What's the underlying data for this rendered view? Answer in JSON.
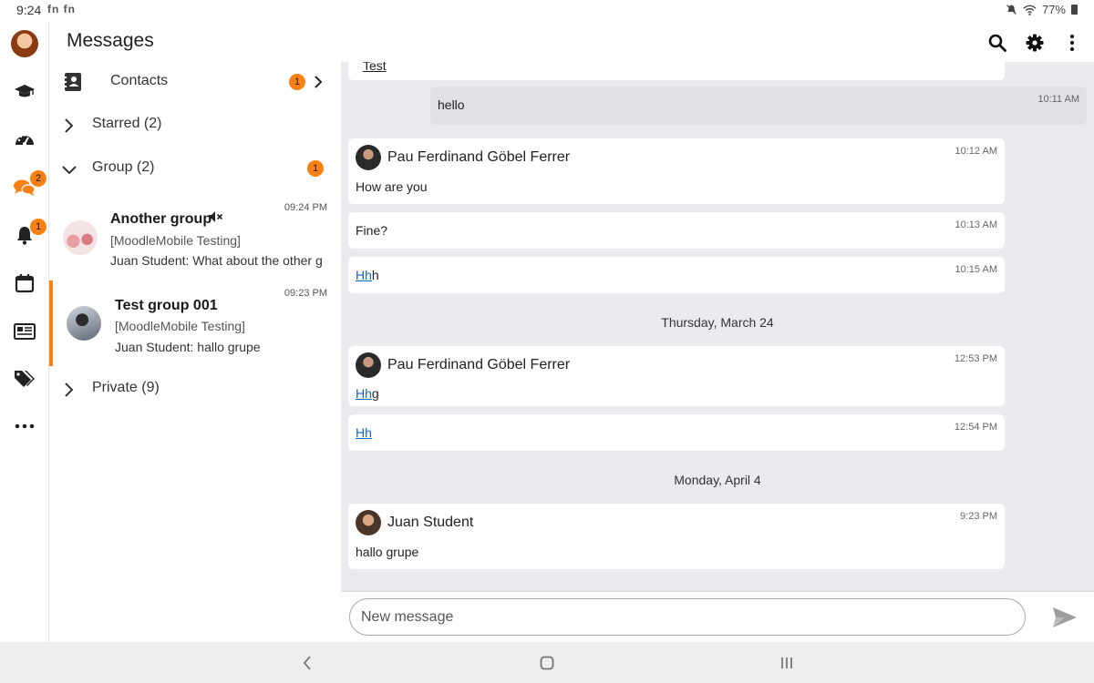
{
  "status_bar": {
    "time": "9:24",
    "left_icons": "fn fn",
    "battery": "77%"
  },
  "rail": {
    "items": [
      {
        "name": "user-avatar"
      },
      {
        "name": "courses-icon"
      },
      {
        "name": "dashboard-icon"
      },
      {
        "name": "messages-icon",
        "badge": "2"
      },
      {
        "name": "notifications-icon",
        "badge": "1"
      },
      {
        "name": "calendar-icon"
      },
      {
        "name": "news-icon"
      },
      {
        "name": "tags-icon"
      },
      {
        "name": "more-icon"
      }
    ]
  },
  "header": {
    "title": "Messages"
  },
  "list": {
    "contacts": {
      "label": "Contacts",
      "badge": "1"
    },
    "starred": {
      "label": "Starred (2)"
    },
    "group": {
      "label": "Group (2)",
      "badge": "1"
    },
    "private": {
      "label": "Private (9)"
    },
    "conversations": [
      {
        "name": "Another group",
        "course": "[MoodleMobile Testing]",
        "last_author": "Juan Student:",
        "last_text": "What about the other g",
        "time": "09:24 PM",
        "muted": true
      },
      {
        "name": "Test group 001",
        "course": "[MoodleMobile Testing]",
        "last_author": "Juan Student:",
        "last_text": "hallo grupe",
        "time": "09:23 PM",
        "selected": true
      }
    ]
  },
  "messages": {
    "top_partial": {
      "text": "Test"
    },
    "items": [
      {
        "mine": true,
        "text": "hello",
        "time": "10:11 AM"
      },
      {
        "author": "Pau Ferdinand Göbel Ferrer",
        "text": "How are you",
        "time": "10:12 AM"
      },
      {
        "text": "Fine?",
        "time": "10:13 AM"
      },
      {
        "link": "Hh",
        "text": "h",
        "time": "10:15 AM"
      },
      {
        "author": "Pau Ferdinand Göbel Ferrer",
        "link": "Hh",
        "text": "g",
        "time": "12:53 PM"
      },
      {
        "link": "Hh",
        "text": "",
        "time": "12:54 PM"
      },
      {
        "author": "Juan Student",
        "text": "hallo grupe",
        "time": "9:23 PM"
      }
    ],
    "day_separators": [
      "Thursday, March 24",
      "Monday, April 4"
    ]
  },
  "composer": {
    "placeholder": "New message"
  },
  "colors": {
    "accent": "#f98012",
    "link": "#1565c0",
    "pane_bg": "#e9ebee",
    "mine_bubble": "#dfe1e5"
  }
}
